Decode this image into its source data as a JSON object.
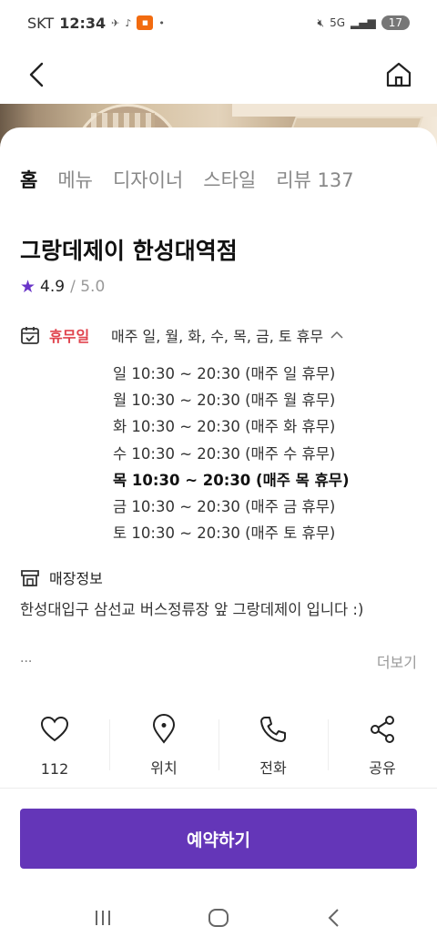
{
  "status_bar": {
    "carrier": "SKT",
    "time": "12:34",
    "battery": "17",
    "network": "5G"
  },
  "tabs": [
    {
      "label": "홈",
      "active": true
    },
    {
      "label": "메뉴"
    },
    {
      "label": "디자이너"
    },
    {
      "label": "스타일"
    },
    {
      "label": "리뷰 137"
    }
  ],
  "store": {
    "name": "그랑데제이 한성대역점",
    "rating": "4.9",
    "rating_max": "/ 5.0"
  },
  "hours": {
    "holiday_label": "휴무일",
    "holiday_desc": "매주 일, 월, 화, 수, 목, 금, 토 휴무",
    "days": [
      "일 10:30 ~ 20:30 (매주 일 휴무)",
      "월 10:30 ~ 20:30 (매주 월 휴무)",
      "화 10:30 ~ 20:30 (매주 화 휴무)",
      "수 10:30 ~ 20:30 (매주 수 휴무)",
      "목 10:30 ~ 20:30 (매주 목 휴무)",
      "금 10:30 ~ 20:30 (매주 금 휴무)",
      "토 10:30 ~ 20:30 (매주 토 휴무)"
    ],
    "today_index": 4
  },
  "store_info": {
    "title": "매장정보",
    "description": "한성대입구 삼선교 버스정류장 앞 그랑데제이 입니다 :)",
    "ellipsis": "...",
    "more_label": "더보기"
  },
  "actions": [
    {
      "icon": "heart-icon",
      "label": "112"
    },
    {
      "icon": "location-pin-icon",
      "label": "위치"
    },
    {
      "icon": "phone-icon",
      "label": "전화"
    },
    {
      "icon": "share-icon",
      "label": "공유"
    }
  ],
  "reserve_button": "예약하기",
  "colors": {
    "accent": "#6436b8",
    "holiday": "#e0434d",
    "star": "#6a35c8"
  }
}
